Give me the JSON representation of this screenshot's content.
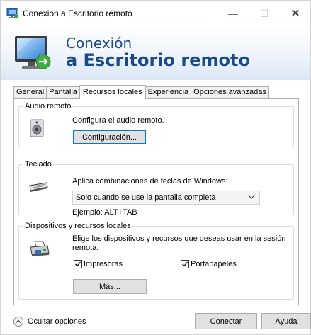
{
  "window": {
    "title": "Conexión a Escritorio remoto",
    "controls": {
      "minimize": "—",
      "maximize": "☐",
      "close": "✕"
    }
  },
  "banner": {
    "line1": "Conexión",
    "line2": "a Escritorio remoto",
    "icon": "remote-desktop-monitor-icon"
  },
  "tabs": [
    {
      "label": "General"
    },
    {
      "label": "Pantalla"
    },
    {
      "label": "Recursos locales",
      "active": true
    },
    {
      "label": "Experiencia"
    },
    {
      "label": "Opciones avanzadas"
    }
  ],
  "audio": {
    "legend": "Audio remoto",
    "description": "Configura el audio remoto.",
    "button": "Configuración...",
    "icon": "speaker-icon"
  },
  "keyboard": {
    "legend": "Teclado",
    "description": "Aplica combinaciones de teclas de Windows:",
    "selected": "Solo cuando se use la pantalla completa",
    "example": "Ejemplo: ALT+TAB",
    "icon": "keyboard-icon"
  },
  "devices": {
    "legend": "Dispositivos y recursos locales",
    "description_line1": "Elige los dispositivos y recursos que deseas usar en la sesión",
    "description_line2": "remota.",
    "printers": {
      "label": "Impresoras",
      "checked": true
    },
    "clipboard": {
      "label": "Portapapeles",
      "checked": true
    },
    "more_button": "Más...",
    "icon": "printer-icon"
  },
  "footer": {
    "hide_options": "Ocultar opciones",
    "connect": "Conectar",
    "help": "Ayuda"
  },
  "colors": {
    "banner_text": "#1a4a87",
    "focus_border": "#0078d7"
  }
}
